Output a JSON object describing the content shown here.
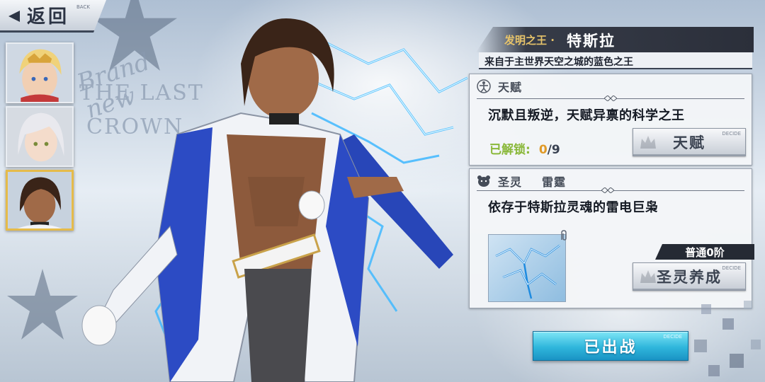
{
  "back": {
    "label": "返回",
    "sub": "BACK"
  },
  "background": {
    "line1": "Brand new",
    "line2": "THE LAST",
    "line3": "CROWN"
  },
  "portraits": [
    {
      "name": "blonde-hero-portrait"
    },
    {
      "name": "silver-hair-portrait"
    },
    {
      "name": "tesla-portrait"
    }
  ],
  "hero": {
    "title": "发明之王 ·",
    "name": "特斯拉",
    "subtitle": "来自于主世界天空之城的蓝色之王"
  },
  "talent": {
    "header": "天赋",
    "description": "沉默且叛逆，天赋异禀的科学之王",
    "unlock_label": "已解锁:",
    "unlock_current": "0",
    "unlock_total": "/9",
    "button_label": "天赋",
    "button_tag": "DECIDE"
  },
  "spirit": {
    "header_prefix": "圣灵",
    "header_name": "雷霆",
    "description": "依存于特斯拉灵魂的雷电巨枭",
    "level": "普通0阶",
    "button_label": "圣灵养成",
    "button_tag": "DECIDE"
  },
  "deploy": {
    "label": "已出战",
    "tag": "DECIDE"
  },
  "colors": {
    "accent_gold": "#e6c36a",
    "unlock_green": "#8ab83a",
    "deploy_cyan": "#2fb6dc",
    "selected_border": "#e5bb4a"
  }
}
